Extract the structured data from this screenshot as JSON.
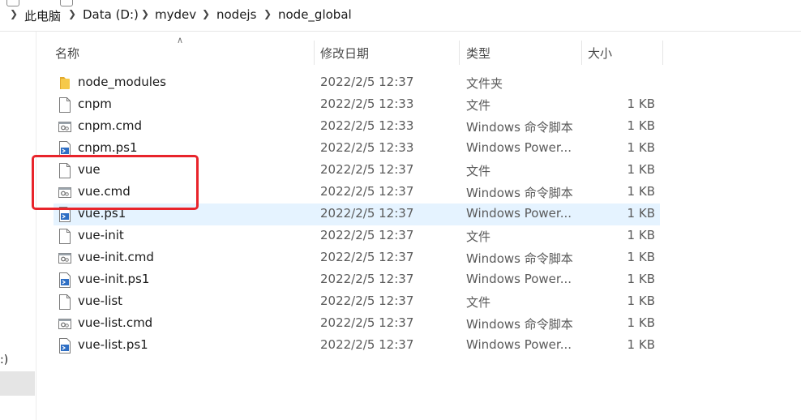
{
  "breadcrumb": {
    "items": [
      "此电脑",
      "Data (D:)",
      "mydev",
      "nodejs",
      "node_global"
    ]
  },
  "nav": {
    "partial_text": ":)"
  },
  "columns": {
    "name": "名称",
    "modified": "修改日期",
    "type": "类型",
    "size": "大小"
  },
  "files": [
    {
      "name": "node_modules",
      "date": "2022/2/5 12:37",
      "type": "文件夹",
      "size": "",
      "icon": "folder-icon"
    },
    {
      "name": "cnpm",
      "date": "2022/2/5 12:33",
      "type": "文件",
      "size": "1 KB",
      "icon": "file-icon"
    },
    {
      "name": "cnpm.cmd",
      "date": "2022/2/5 12:33",
      "type": "Windows 命令脚本",
      "size": "1 KB",
      "icon": "cmd-script-icon"
    },
    {
      "name": "cnpm.ps1",
      "date": "2022/2/5 12:33",
      "type": "Windows Power...",
      "size": "1 KB",
      "icon": "powershell-script-icon"
    },
    {
      "name": "vue",
      "date": "2022/2/5 12:37",
      "type": "文件",
      "size": "1 KB",
      "icon": "file-icon"
    },
    {
      "name": "vue.cmd",
      "date": "2022/2/5 12:37",
      "type": "Windows 命令脚本",
      "size": "1 KB",
      "icon": "cmd-script-icon"
    },
    {
      "name": "vue.ps1",
      "date": "2022/2/5 12:37",
      "type": "Windows Power...",
      "size": "1 KB",
      "icon": "powershell-script-icon"
    },
    {
      "name": "vue-init",
      "date": "2022/2/5 12:37",
      "type": "文件",
      "size": "1 KB",
      "icon": "file-icon"
    },
    {
      "name": "vue-init.cmd",
      "date": "2022/2/5 12:37",
      "type": "Windows 命令脚本",
      "size": "1 KB",
      "icon": "cmd-script-icon"
    },
    {
      "name": "vue-init.ps1",
      "date": "2022/2/5 12:37",
      "type": "Windows Power...",
      "size": "1 KB",
      "icon": "powershell-script-icon"
    },
    {
      "name": "vue-list",
      "date": "2022/2/5 12:37",
      "type": "文件",
      "size": "1 KB",
      "icon": "file-icon"
    },
    {
      "name": "vue-list.cmd",
      "date": "2022/2/5 12:37",
      "type": "Windows 命令脚本",
      "size": "1 KB",
      "icon": "cmd-script-icon"
    },
    {
      "name": "vue-list.ps1",
      "date": "2022/2/5 12:37",
      "type": "Windows Power...",
      "size": "1 KB",
      "icon": "powershell-script-icon"
    }
  ],
  "selected_file": "vue.ps1",
  "highlighted_files": [
    "vue",
    "vue.cmd"
  ],
  "colors": {
    "selection": "#e5f3ff",
    "highlight_box": "#e8242b",
    "folder": "#f4c542"
  }
}
